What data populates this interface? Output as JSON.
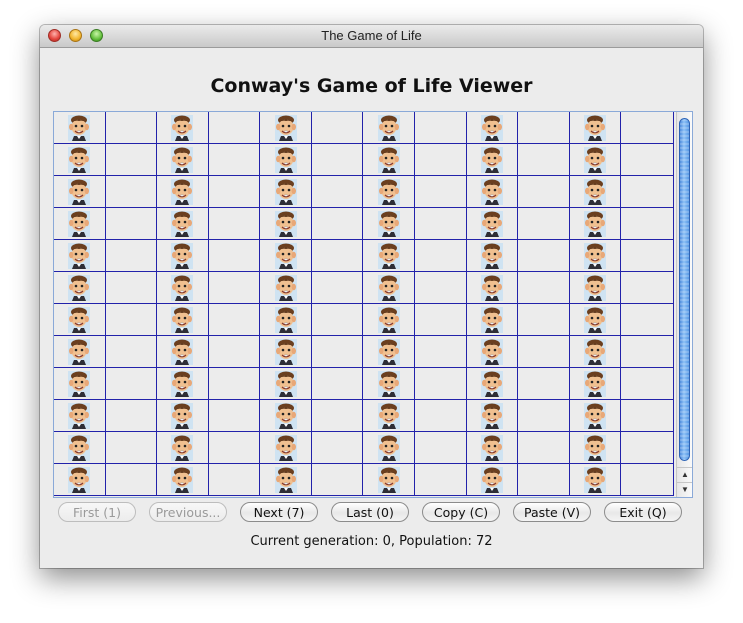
{
  "window": {
    "title": "The Game of Life"
  },
  "heading": "Conway's Game of Life Viewer",
  "grid": {
    "columns": 12,
    "visible_rows": 12,
    "alive_icon": "alfred-e-neuman-face-icon",
    "alive_columns": [
      0,
      2,
      4,
      6,
      8,
      10
    ]
  },
  "buttons": {
    "first": "First (1)",
    "previous": "Previous...",
    "next": "Next (7)",
    "last": "Last (0)",
    "copy": "Copy (C)",
    "paste": "Paste (V)",
    "exit": "Exit (Q)"
  },
  "status": "Current generation: 0, Population: 72",
  "colors": {
    "grid_line": "#2222aa",
    "scroll_thumb": "#5b9ae8"
  }
}
